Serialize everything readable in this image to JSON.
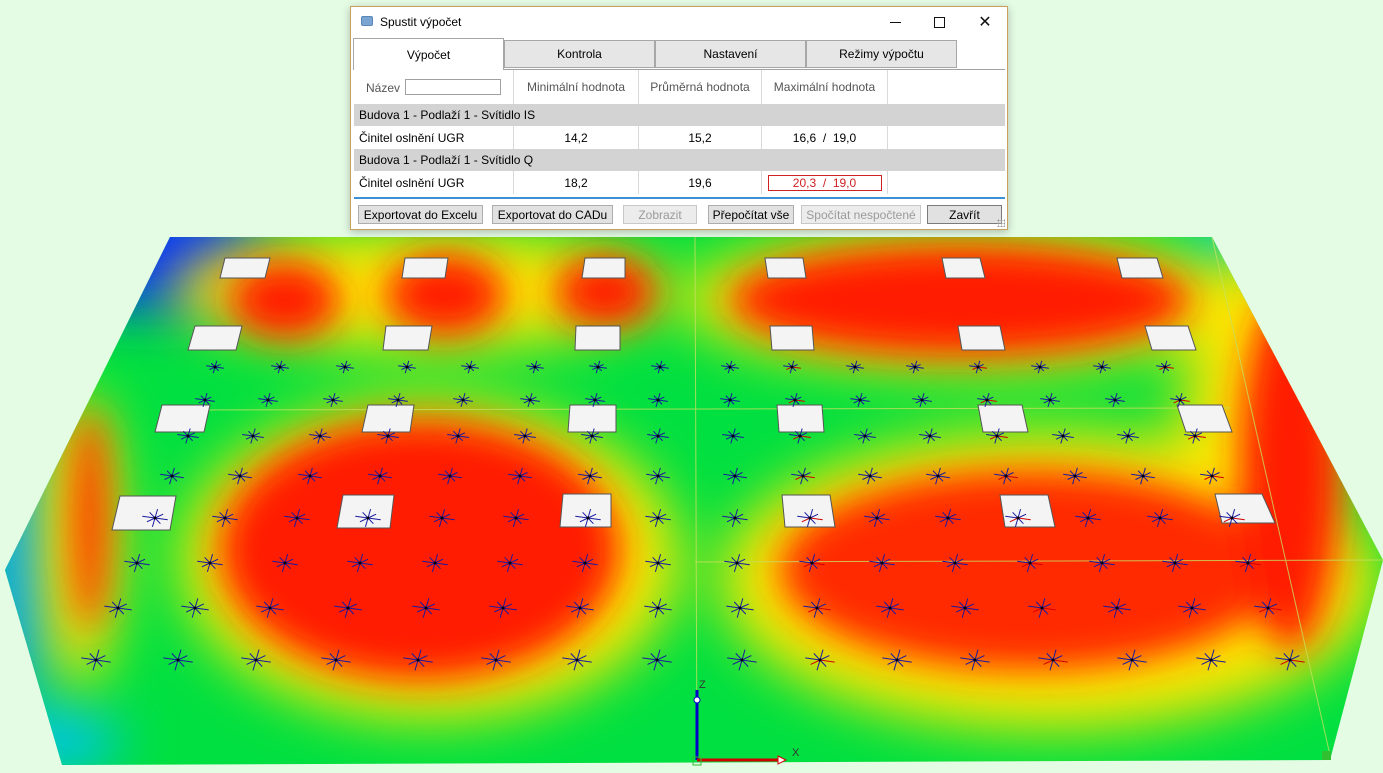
{
  "dialog": {
    "title": "Spustit výpočet",
    "tabs": [
      {
        "label": "Výpočet"
      },
      {
        "label": "Kontrola"
      },
      {
        "label": "Nastavení"
      },
      {
        "label": "Režimy výpočtu"
      }
    ],
    "table": {
      "name_label": "Název",
      "name_value": "",
      "columns": [
        "Minimální hodnota",
        "Průměrná hodnota",
        "Maximální hodnota"
      ],
      "groups": [
        {
          "title": "Budova 1 - Podlaží 1 - Svítidlo IS",
          "rows": [
            {
              "name": "Činitel oslnění UGR",
              "min": "14,2",
              "avg": "15,2",
              "max": "16,6  /  19,0",
              "exceeded": false
            }
          ]
        },
        {
          "title": "Budova 1 - Podlaží 1 - Svítidlo Q",
          "rows": [
            {
              "name": "Činitel oslnění UGR",
              "min": "18,2",
              "avg": "19,6",
              "max": "20,3  /  19,0",
              "exceeded": true
            }
          ]
        }
      ]
    },
    "buttons": {
      "export_excel": "Exportovat do Excelu",
      "export_cad": "Exportovat do CADu",
      "show": "Zobrazit",
      "recalc_all": "Přepočítat vše",
      "calc_uncalculated": "Spočítat nespočtené",
      "close": "Zavřít"
    }
  },
  "viewport": {
    "axis_z_label": "Z",
    "axis_x_label": "X",
    "colors": {
      "background": "#e4fbe4",
      "heat_high": "#ff1e00",
      "heat_mid": "#ffe600",
      "heat_low": "#00e040",
      "heat_min": "#0030ff",
      "arrow": "#1a1aa0",
      "axis_x": "#d00000",
      "axis_z": "#0000c8"
    }
  }
}
